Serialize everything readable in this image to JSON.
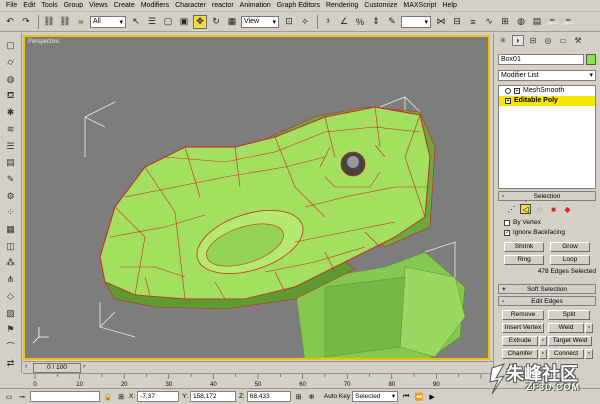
{
  "menu": [
    "File",
    "Edit",
    "Tools",
    "Group",
    "Views",
    "Create",
    "Modifiers",
    "Character",
    "reactor",
    "Animation",
    "Graph Editors",
    "Rendering",
    "Customize",
    "MAXScript",
    "Help"
  ],
  "toolbar": {
    "filter_value": "All",
    "refcoord_value": "View"
  },
  "viewport": {
    "label": "Perspective",
    "mesh_color": "#a3e060",
    "edge_color": "#c8281e",
    "background": "#7d7d7d"
  },
  "command_panel": {
    "object_name": "Box01",
    "color_swatch": "#8de14b",
    "modifier_list": "Modifier List",
    "stack": [
      {
        "label": "MeshSmooth",
        "selected": false
      },
      {
        "label": "Editable Poly",
        "selected": true
      }
    ],
    "selection": {
      "title": "Selection",
      "by_vertex": "By Vertex",
      "ignore_backfacing": "Ignore Backfacing",
      "shrink": "Shrink",
      "grow": "Grow",
      "ring": "Ring",
      "loop": "Loop",
      "status": "478 Edges Selected"
    },
    "soft_selection": {
      "title": "Soft Selection"
    },
    "edit_edges": {
      "title": "Edit Edges",
      "remove": "Remove",
      "split": "Split",
      "insert_vertex": "Insert Vertex",
      "weld": "Weld",
      "extrude": "Extrude",
      "target_weld": "Target Weld",
      "chamfer": "Chamfer",
      "connect": "Connect"
    }
  },
  "time": {
    "frame": "0 / 100",
    "ticks": [
      "0",
      "10",
      "20",
      "30",
      "40",
      "50",
      "60",
      "70",
      "80",
      "90"
    ]
  },
  "status": {
    "x_label": "X:",
    "x_value": "-7,37",
    "y_label": "Y:",
    "y_value": "158,172",
    "z_label": "Z:",
    "z_value": "68,433",
    "autokey": "Auto Key",
    "selected": "Selected"
  },
  "watermark": {
    "main": "朱峰社区",
    "sub": "ZF3D.COM"
  }
}
